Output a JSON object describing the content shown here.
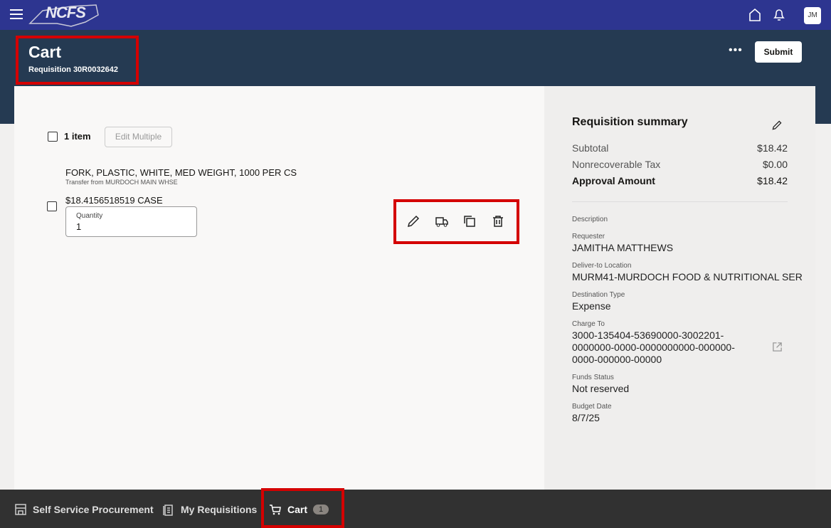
{
  "app": {
    "logo": "NCFS",
    "avatar_initials": "JM"
  },
  "header": {
    "title": "Cart",
    "subtitle": "Requisition 30R0032642",
    "more": "•••",
    "submit": "Submit"
  },
  "cart": {
    "item_count": "1 item",
    "edit_multiple": "Edit Multiple",
    "item": {
      "name": "FORK, PLASTIC, WHITE, MED WEIGHT, 1000 PER CS",
      "source": "Transfer from MURDOCH MAIN WHSE",
      "price": "$18.4156518519 CASE",
      "quantity_label": "Quantity",
      "quantity": "1"
    }
  },
  "summary": {
    "title": "Requisition summary",
    "subtotal_label": "Subtotal",
    "subtotal": "$18.42",
    "tax_label": "Nonrecoverable Tax",
    "tax": "$0.00",
    "approval_label": "Approval Amount",
    "approval": "$18.42",
    "description_label": "Description",
    "requester_label": "Requester",
    "requester": "JAMITHA MATTHEWS",
    "deliver_label": "Deliver-to Location",
    "deliver": "MURM41-MURDOCH FOOD & NUTRITIONAL SER",
    "dest_label": "Destination Type",
    "dest": "Expense",
    "charge_label": "Charge To",
    "charge1": "3000-135404-53690000-3002201-",
    "charge2": "0000000-0000-0000000000-000000-",
    "charge3": "0000-000000-00000",
    "funds_label": "Funds Status",
    "funds": "Not reserved",
    "budget_label": "Budget Date",
    "budget": "8/7/25"
  },
  "nav": {
    "ssp": "Self Service Procurement",
    "reqs": "My Requisitions",
    "cart": "Cart",
    "cart_count": "1"
  }
}
